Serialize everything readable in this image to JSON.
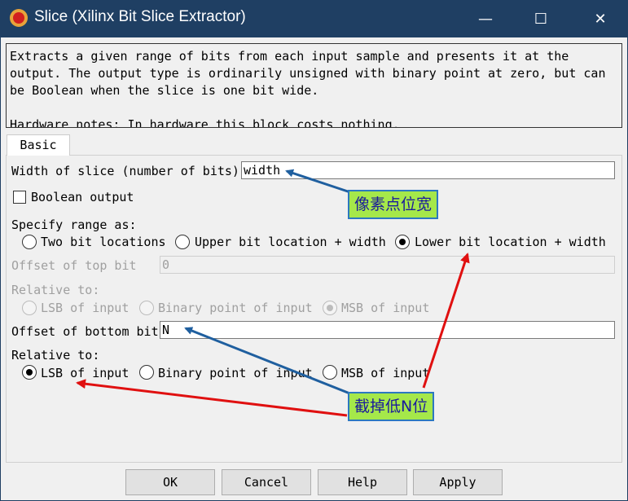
{
  "window": {
    "title": "Slice (Xilinx Bit Slice Extractor)",
    "minimize": "—",
    "maximize": "☐",
    "close": "✕"
  },
  "description": "Extracts a given range of bits from each input sample and presents it at the\noutput. The output type is ordinarily unsigned with binary point at zero, but can\nbe Boolean when the slice is one bit wide.\n\nHardware notes: In hardware this block costs nothing.",
  "tabs": [
    {
      "label": "Basic",
      "selected": true
    }
  ],
  "form": {
    "width_label": "Width of slice (number of bits)",
    "width_value": "width",
    "boolean_label": "Boolean output",
    "boolean_checked": false,
    "range_label": "Specify range as:",
    "range_options": [
      {
        "label": "Two bit locations",
        "selected": false
      },
      {
        "label": "Upper bit location + width",
        "selected": false
      },
      {
        "label": "Lower bit location + width",
        "selected": true
      }
    ],
    "offset_top_label": "Offset of top bit",
    "offset_top_value": "0",
    "relative_top_label": "Relative to:",
    "relative_top_options": [
      {
        "label": "LSB of input",
        "selected": false
      },
      {
        "label": "Binary point of input",
        "selected": false
      },
      {
        "label": "MSB of input",
        "selected": true
      }
    ],
    "offset_bottom_label": "Offset of bottom bit",
    "offset_bottom_value": "N",
    "relative_bottom_label": "Relative to:",
    "relative_bottom_options": [
      {
        "label": "LSB of input",
        "selected": true
      },
      {
        "label": "Binary point of input",
        "selected": false
      },
      {
        "label": "MSB of input",
        "selected": false
      }
    ]
  },
  "annotations": {
    "pixel_width": "像素点位宽",
    "truncate_low_bits": "截掉低N位"
  },
  "buttons": {
    "ok": "OK",
    "cancel": "Cancel",
    "help": "Help",
    "apply": "Apply"
  },
  "colors": {
    "titlebar": "#1f3f63",
    "callout_fill": "#a5e84a",
    "callout_border": "#2c78c0",
    "arrow_blue": "#1f5f9f",
    "arrow_red": "#e01010"
  }
}
